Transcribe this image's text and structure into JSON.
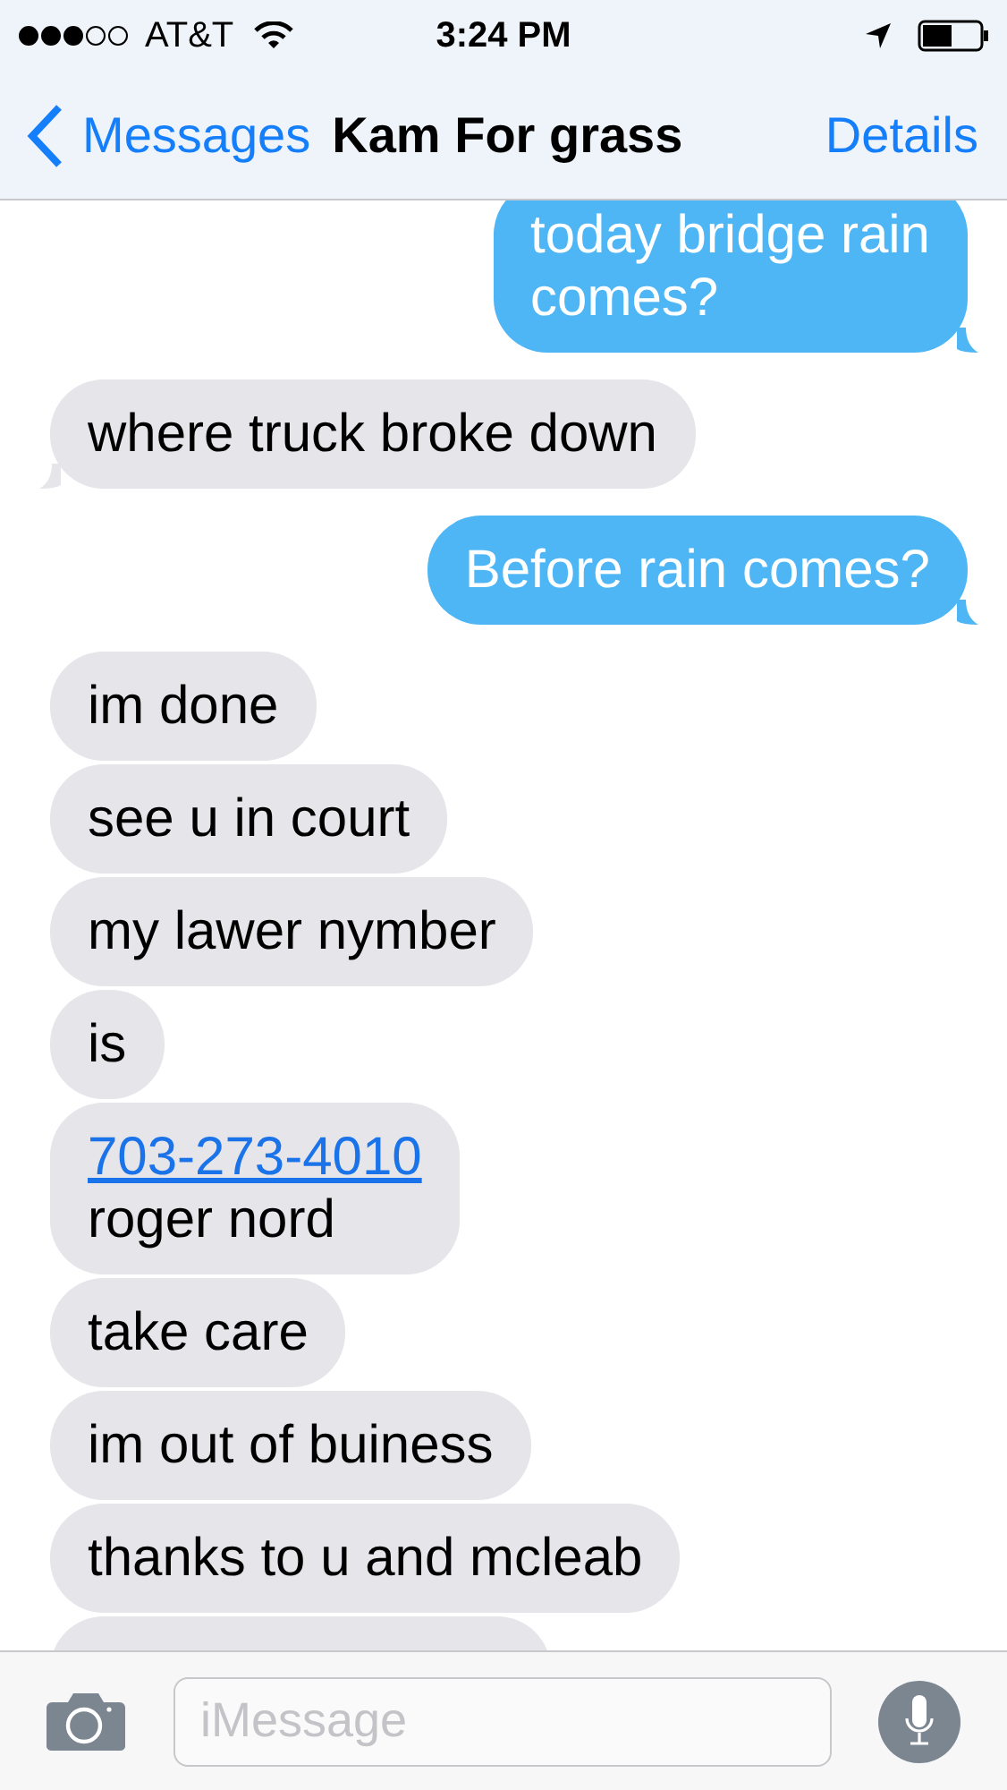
{
  "status_bar": {
    "carrier": "AT&T",
    "time": "3:24 PM"
  },
  "nav": {
    "back": "Messages",
    "title": "Kam For grass",
    "action": "Details"
  },
  "messages": [
    {
      "outgoing": true,
      "kind": "text",
      "text": "today bridge rain\ncomes?"
    },
    {
      "outgoing": false,
      "kind": "text",
      "text": "where truck broke down"
    },
    {
      "outgoing": true,
      "kind": "text",
      "text": "Before rain comes?"
    },
    {
      "outgoing": false,
      "kind": "text",
      "text": "im done"
    },
    {
      "outgoing": false,
      "kind": "text",
      "text": "see u in court"
    },
    {
      "outgoing": false,
      "kind": "text",
      "text": "my lawer nymber"
    },
    {
      "outgoing": false,
      "kind": "text",
      "text": "is"
    },
    {
      "outgoing": false,
      "kind": "link",
      "link": "703-273-4010",
      "text": "roger nord"
    },
    {
      "outgoing": false,
      "kind": "text",
      "text": "take care"
    },
    {
      "outgoing": false,
      "kind": "text",
      "text": "im out of buiness"
    },
    {
      "outgoing": false,
      "kind": "text",
      "text": "thanks to u and mcleab"
    },
    {
      "outgoing": false,
      "kind": "cut"
    }
  ],
  "composer": {
    "placeholder": "iMessage"
  }
}
